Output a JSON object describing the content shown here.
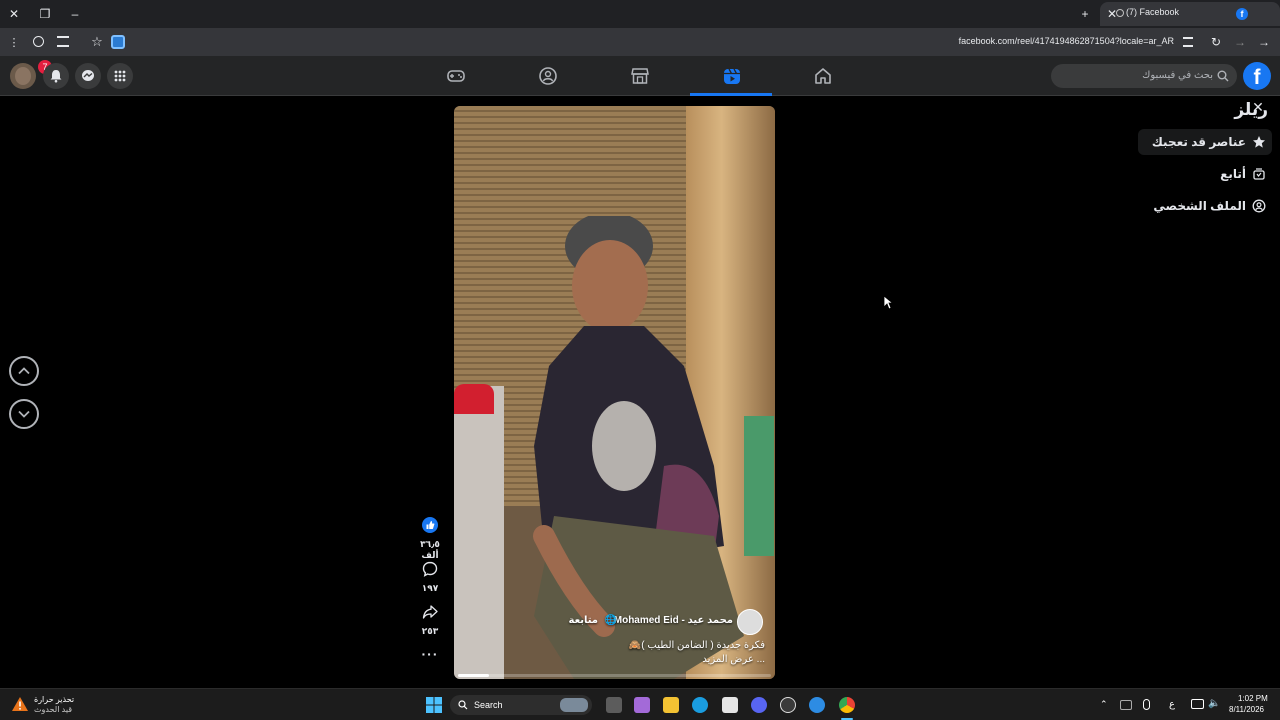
{
  "browser": {
    "tab_title": "(7) Facebook",
    "url": "facebook.com/reel/4174194862871504?locale=ar_AR"
  },
  "header": {
    "notification_count": "7",
    "search_placeholder": "بحث في فيسبوك",
    "nav_items": [
      "gaming-icon",
      "groups-icon",
      "marketplace-icon",
      "reels-icon",
      "home-icon"
    ],
    "active_nav": "reels-icon"
  },
  "sidebar": {
    "title": "ريلز",
    "items": [
      {
        "label": "عناصر قد تعجبك",
        "icon": "star-icon",
        "active": true
      },
      {
        "label": "أتابع",
        "icon": "following-icon",
        "active": false
      },
      {
        "label": "الملف الشخصي",
        "icon": "profile-icon",
        "active": false
      }
    ]
  },
  "reel": {
    "author": "محمد عيد - Mohamed Eid",
    "follow_label": "متابعة",
    "caption": "فكرة جديدة ( الضامن الطيب )🙈",
    "see_more": "... عرض المزيد",
    "progress": 0.1,
    "likes": "٣٦٫٥ ألف",
    "comments": "١٩٧",
    "shares": "٢٥٣"
  },
  "taskbar": {
    "weather_title": "تحذير حرارة",
    "weather_sub": "قيد الحدوث",
    "search_label": "Search",
    "time": "1:02 PM",
    "date": "8/11/2026",
    "lang": "ع"
  },
  "colors": {
    "accent": "#1877f2",
    "badge": "#e41e3f"
  }
}
